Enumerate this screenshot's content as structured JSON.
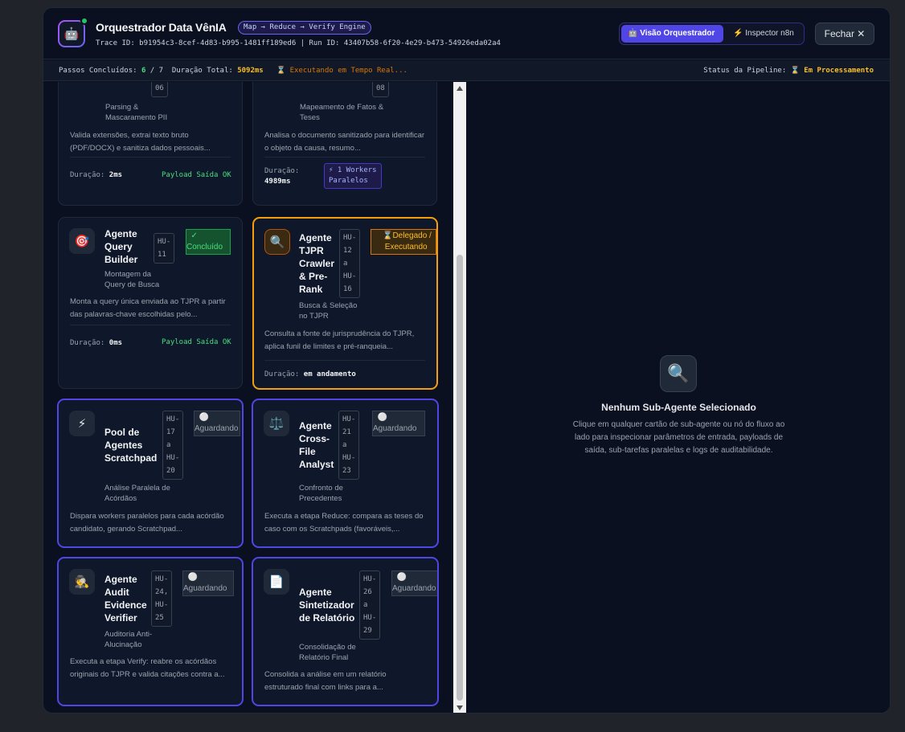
{
  "header": {
    "title": "Orquestrador Data VênIA",
    "engine_badge": "Map → Reduce → Verify Engine",
    "trace_line": "Trace ID: b91954c3-8cef-4d83-b995-1481ff189ed6 | Run ID: 43407b58-6f20-4e29-b473-54926eda02a4",
    "view_orchestrator": "🤖 Visão Orquestrador",
    "view_inspector": "⚡ Inspector n8n",
    "close_label": "Fechar ✕"
  },
  "status_bar": {
    "steps_label": "Passos Concluídos:",
    "steps_done": "6",
    "steps_total": "/ 7",
    "duration_label": "Duração Total:",
    "duration_value": "5092ms",
    "live": "⌛ Executando em Tempo Real...",
    "pipeline_label": "Status da Pipeline:",
    "pipeline_value": "⌛ Em Processamento"
  },
  "cards": [
    {
      "hu": "06",
      "subtitle": "Parsing &\nMascaramento PII",
      "desc": "Valida extensões, extrai texto bruto (PDF/DOCX) e sanitiza dados pessoais...",
      "duration_label": "Duração:",
      "duration": "2ms",
      "payload": "Payload Saída OK"
    },
    {
      "hu": "08",
      "subtitle": "Mapeamento de Fatos &\nTeses",
      "desc": "Analisa o documento sanitizado para identificar o objeto da causa, resumo...",
      "duration_label": "Duração:",
      "duration": "4989ms",
      "workers": "⚡ 1 Workers\nParalelos"
    },
    {
      "icon": "🎯",
      "name": "Agente\nQuery\nBuilder",
      "hu": "HU-\n11",
      "status": "  ✓\nConcluído",
      "subtitle": "Montagem da\nQuery de Busca",
      "desc": "Monta a query única enviada ao TJPR a partir das palavras-chave escolhidas pelo...",
      "duration_label": "Duração:",
      "duration": "0ms",
      "payload": "Payload Saída OK"
    },
    {
      "icon": "🔍",
      "name": "Agente\nTJPR\nCrawler\n& Pre-\nRank",
      "hu": "HU-\n12\na\nHU-\n16",
      "status": "⌛Delegado /\n Executando",
      "subtitle": "Busca & Seleção\nno TJPR",
      "desc": "Consulta a fonte de jurisprudência do TJPR, aplica funil de limites e pré-ranqueia...",
      "duration_label": "Duração:",
      "duration": "em andamento"
    },
    {
      "icon": "⚡",
      "name": "Pool de\nAgentes\nScratchpad",
      "hu": "HU-\n17\na\nHU-\n20",
      "status": "  ⚪\nAguardando",
      "subtitle": "Análise Paralela de\nAcórdãos",
      "desc": "Dispara workers paralelos para cada acórdão candidato, gerando Scratchpad..."
    },
    {
      "icon": "⚖️",
      "name": "Agente\nCross-\nFile\nAnalyst",
      "hu": "HU-\n21\na\nHU-\n23",
      "status": "  ⚪\nAguardando",
      "subtitle": "Confronto de\nPrecedentes",
      "desc": "Executa a etapa Reduce: compara as teses do caso com os Scratchpads (favoráveis,..."
    },
    {
      "icon": "🕵️",
      "name": "Agente\nAudit\nEvidence\nVerifier",
      "hu": "HU-\n24,\nHU-\n25",
      "status": "  ⚪\nAguardando",
      "subtitle": "Auditoria Anti-\nAlucinação",
      "desc": "Executa a etapa Verify: reabre os acórdãos originais do TJPR e valida citações contra a..."
    },
    {
      "icon": "📄",
      "name": "Agente\nSintetizador\nde Relatório",
      "hu": "HU-\n26\na\nHU-\n29",
      "status": "  ⚪\nAguardando",
      "subtitle": "Consolidação de\nRelatório Final",
      "desc": "Consolida a análise em um relatório estruturado final com links para a..."
    }
  ],
  "empty_state": {
    "icon": "magnifier-icon",
    "title": "Nenhum Sub-Agente Selecionado",
    "desc": "Clique em qualquer cartão de sub-agente ou nó do fluxo ao lado para inspecionar parâmetros de entrada, payloads de saída, sub-tarefas paralelas e logs de auditabilidade."
  }
}
